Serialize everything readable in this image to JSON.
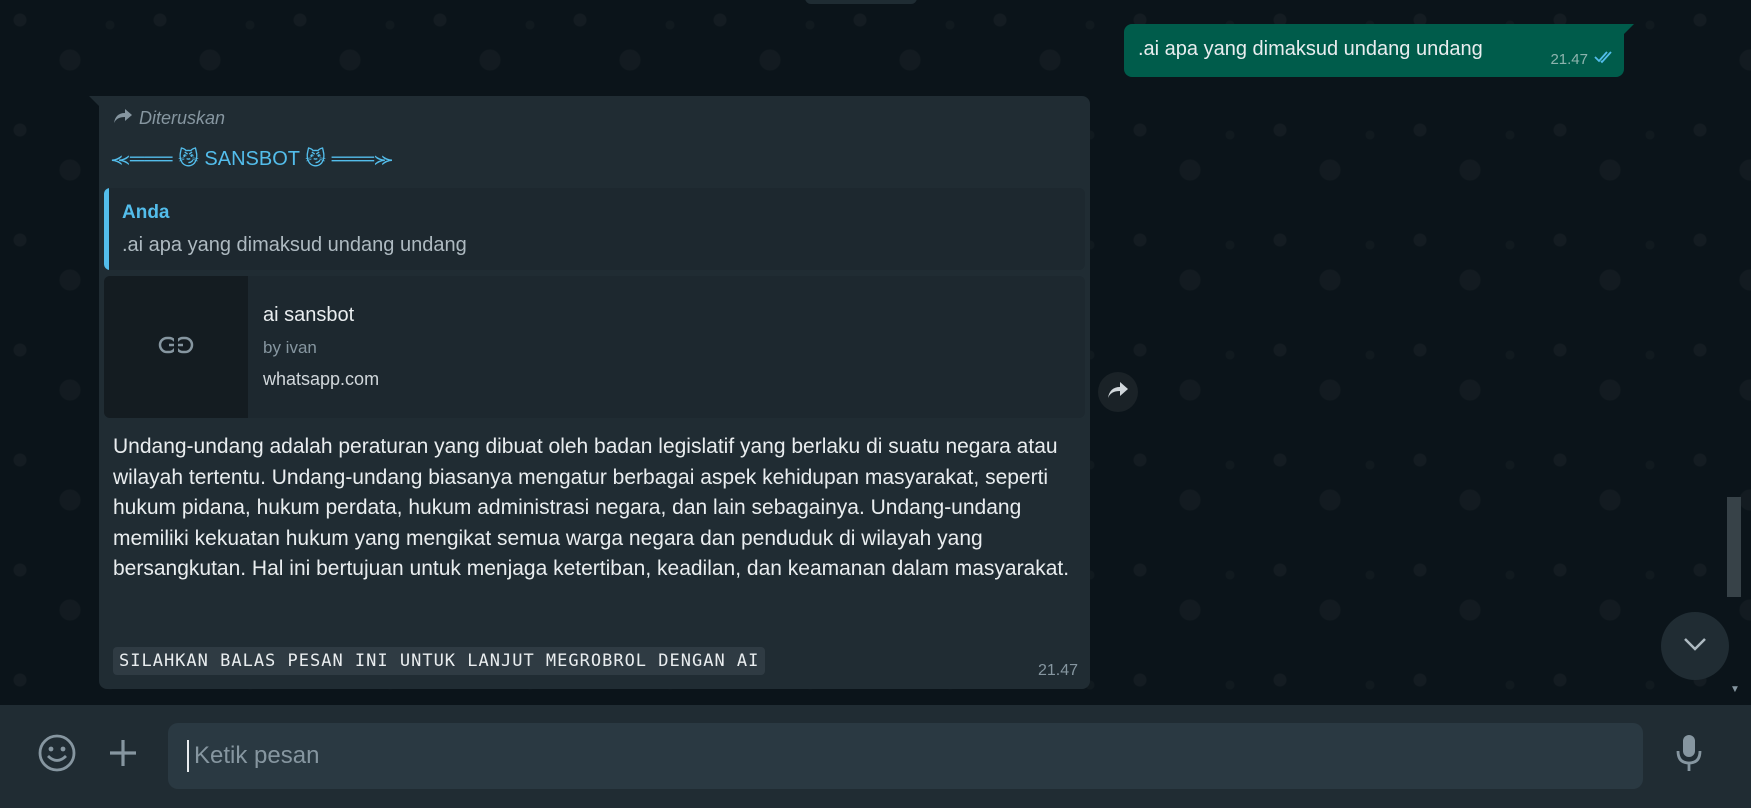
{
  "outgoing": {
    "text": ".ai apa yang dimaksud undang undang",
    "time": "21.47",
    "status": "read-double-check-icon"
  },
  "incoming": {
    "forwarded_label": "Diteruskan",
    "sender_name": "⪻═══ 😼 SANSBOT 😼 ═══⪼",
    "quote": {
      "author": "Anda",
      "text": ".ai apa yang dimaksud undang undang"
    },
    "link_preview": {
      "title": "ai sansbot",
      "description": "by ivan",
      "domain": "whatsapp.com",
      "icon": "link-icon"
    },
    "body": "Undang-undang adalah peraturan yang dibuat oleh badan legislatif yang berlaku di suatu negara atau wilayah tertentu. Undang-undang biasanya mengatur berbagai aspek kehidupan masyarakat, seperti hukum pidana, hukum perdata, hukum administrasi negara, dan lain sebagainya. Undang-undang memiliki kekuatan hukum yang mengikat semua warga negara dan penduduk di wilayah yang bersangkutan. Hal ini bertujuan untuk menjaga ketertiban, keadilan, dan keamanan dalam masyarakat.",
    "footer_mono": "SILAHKAN BALAS PESAN INI UNTUK LANJUT MEGROBROL DENGAN AI",
    "time": "21.47"
  },
  "composer": {
    "placeholder": "Ketik pesan"
  },
  "colors": {
    "background": "#0b141a",
    "outgoing_bubble": "#005c4b",
    "incoming_bubble": "#202c33",
    "accent": "#53bdeb",
    "panel": "#202c33"
  }
}
